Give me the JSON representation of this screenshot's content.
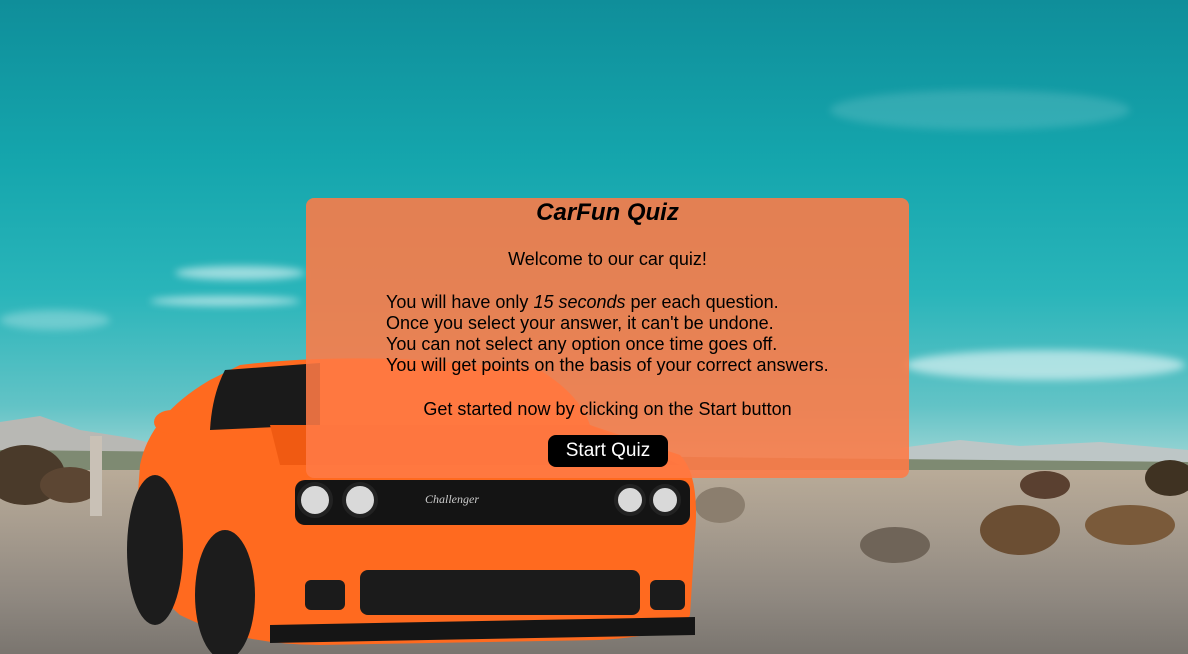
{
  "quiz": {
    "title": "CarFun Quiz",
    "welcome": "Welcome to our car quiz!",
    "rules": {
      "line1_before": "You will have only ",
      "line1_emphasis": "15 seconds",
      "line1_after": " per each question.",
      "line2": "Once you select your answer, it can't be undone.",
      "line3": "You can not select any option once time goes off.",
      "line4": "You will get points on the basis of your correct answers."
    },
    "get_started": "Get started now by clicking on the Start button",
    "start_button": "Start Quiz"
  },
  "background": {
    "car_badge": "Challenger"
  },
  "colors": {
    "overlay": "#ff7a46",
    "button": "#000000",
    "button_text": "#ffffff",
    "car": "#ff6a1f"
  }
}
